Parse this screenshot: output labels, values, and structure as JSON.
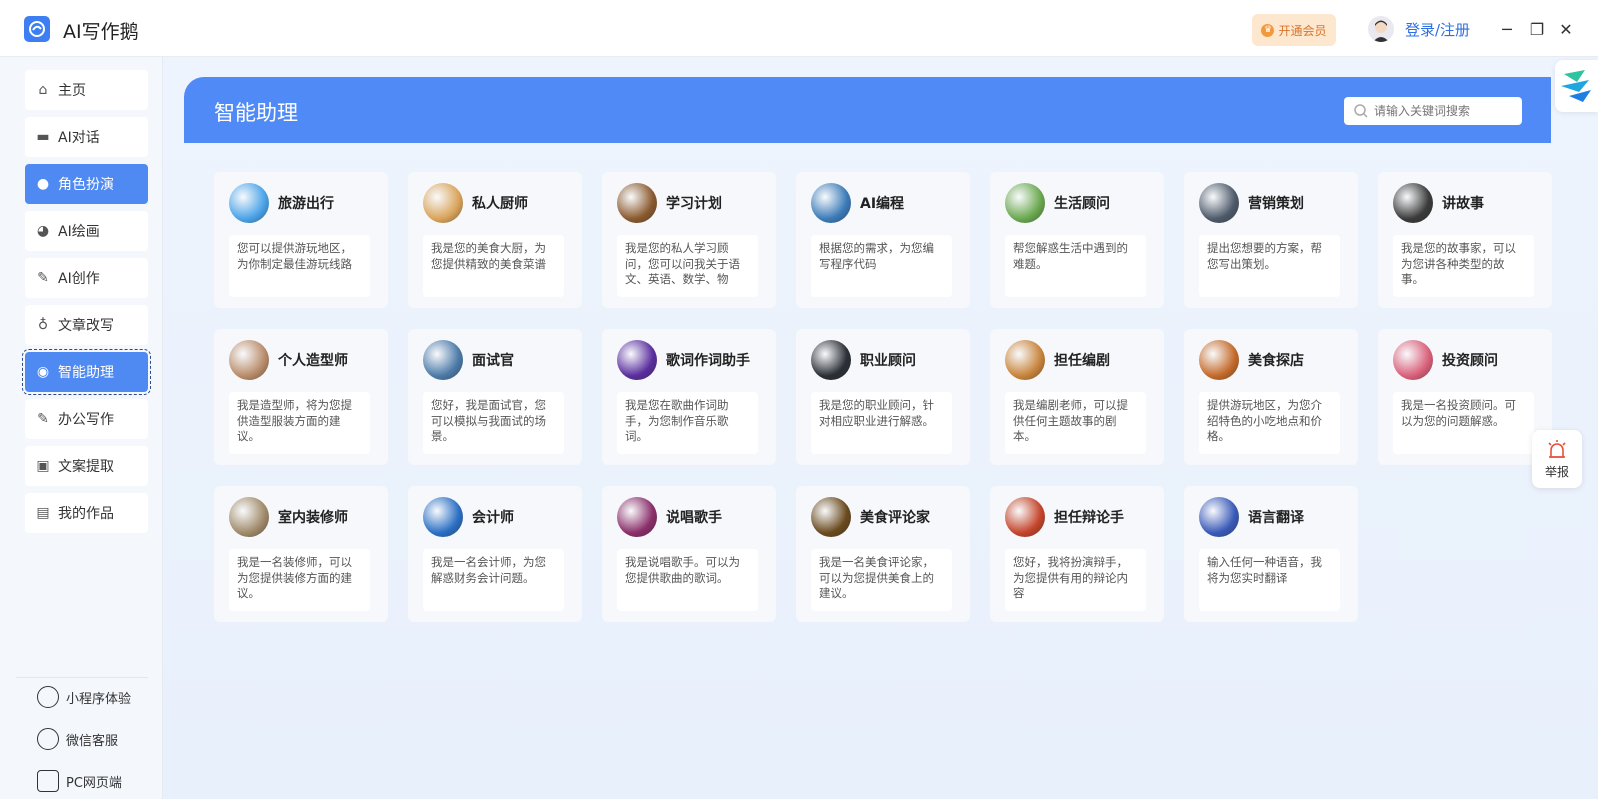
{
  "app": {
    "title": "AI写作鹅"
  },
  "header": {
    "vip_label": "开通会员",
    "login_label": "登录/注册"
  },
  "window_controls": {
    "minimize": "─",
    "maximize": "❐",
    "close": "✕"
  },
  "sidebar": {
    "items": [
      {
        "label": "主页",
        "icon": "home-icon",
        "active": false
      },
      {
        "label": "AI对话",
        "icon": "chat-icon",
        "active": false
      },
      {
        "label": "角色扮演",
        "icon": "mask-icon",
        "active": true
      },
      {
        "label": "AI绘画",
        "icon": "palette-icon",
        "active": false
      },
      {
        "label": "AI创作",
        "icon": "edit-icon",
        "active": false
      },
      {
        "label": "文章改写",
        "icon": "bulb-icon",
        "active": false
      },
      {
        "label": "智能助理",
        "icon": "assistant-icon",
        "active": true
      },
      {
        "label": "办公写作",
        "icon": "edit-icon",
        "active": false
      },
      {
        "label": "文案提取",
        "icon": "text-extract-icon",
        "active": false
      },
      {
        "label": "我的作品",
        "icon": "folder-icon",
        "active": false
      }
    ],
    "bottom": [
      {
        "label": "小程序体验",
        "icon": "miniprogram-icon"
      },
      {
        "label": "微信客服",
        "icon": "wechat-icon"
      },
      {
        "label": "PC网页端",
        "icon": "pc-icon"
      }
    ]
  },
  "main": {
    "title": "智能助理",
    "search_placeholder": "请输入关键词搜索",
    "cards": [
      {
        "title": "旅游出行",
        "desc": "您可以提供游玩地区，为你制定最佳游玩线路",
        "color": "#4aa3e8"
      },
      {
        "title": "私人厨师",
        "desc": "我是您的美食大厨，为您提供精致的美食菜谱",
        "color": "#d9a45a"
      },
      {
        "title": "学习计划",
        "desc": "我是您的私人学习顾问，您可以问我关于语文、英语、数学、物",
        "color": "#8a5a2e"
      },
      {
        "title": "AI编程",
        "desc": "根据您的需求，为您编写程序代码",
        "color": "#3b7bb8"
      },
      {
        "title": "生活顾问",
        "desc": "帮您解惑生活中遇到的难题。",
        "color": "#6aa84f"
      },
      {
        "title": "营销策划",
        "desc": "提出您想要的方案，帮您写出策划。",
        "color": "#4d5a6a"
      },
      {
        "title": "讲故事",
        "desc": "我是您的故事家，可以为您讲各种类型的故事。",
        "color": "#3a3a3a"
      },
      {
        "title": "个人造型师",
        "desc": "我是造型师，将为您提供造型服装方面的建议。",
        "color": "#b98c6a"
      },
      {
        "title": "面试官",
        "desc": "您好，我是面试官，您可以模拟与我面试的场景。",
        "color": "#4c7aa8"
      },
      {
        "title": "歌词作词助手",
        "desc": "我是您在歌曲作词助手，为您制作音乐歌词。",
        "color": "#5a2e9e"
      },
      {
        "title": "职业顾问",
        "desc": "我是您的职业顾问，针对相应职业进行解惑。",
        "color": "#2b2f36"
      },
      {
        "title": "担任编剧",
        "desc": "我是编剧老师，可以提供任何主题故事的剧本。",
        "color": "#c8843c"
      },
      {
        "title": "美食探店",
        "desc": "提供游玩地区，为您介绍特色的小吃地点和价格。",
        "color": "#c46a2a"
      },
      {
        "title": "投资顾问",
        "desc": "我是一名投资顾问。可以为您的问题解惑。",
        "color": "#d9607a"
      },
      {
        "title": "室内装修师",
        "desc": "我是一名装修师，可以为您提供装修方面的建议。",
        "color": "#a08a6a"
      },
      {
        "title": "会计师",
        "desc": "我是一名会计师，为您解惑财务会计问题。",
        "color": "#2b6fc4"
      },
      {
        "title": "说唱歌手",
        "desc": "我是说唱歌手。可以为您提供歌曲的歌词。",
        "color": "#8a2e6a"
      },
      {
        "title": "美食评论家",
        "desc": "我是一名美食评论家，可以为您提供美食上的建议。",
        "color": "#6a4a1e"
      },
      {
        "title": "担任辩论手",
        "desc": "您好，我将扮演辩手，为您提供有用的辩论内容",
        "color": "#c4442a"
      },
      {
        "title": "语言翻译",
        "desc": "输入任何一种语音，我将为您实时翻译",
        "color": "#3a5ab8"
      }
    ]
  },
  "report": {
    "label": "举报"
  }
}
